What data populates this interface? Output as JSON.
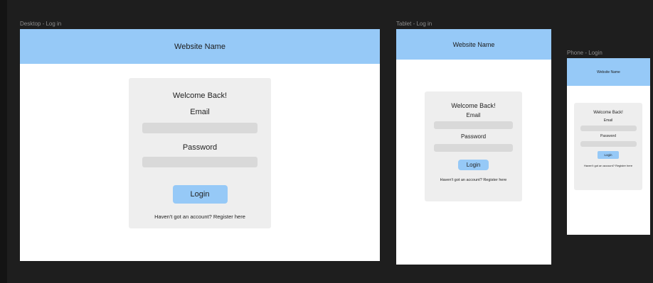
{
  "frames": {
    "desktop": {
      "label": "Desktop - Log in",
      "header": "Website Name",
      "welcome": "Welcome Back!",
      "email_label": "Email",
      "password_label": "Password",
      "login_button": "Login",
      "register_text": "Haven't got an account? Register here"
    },
    "tablet": {
      "label": "Tablet - Log in",
      "header": "Website Name",
      "welcome": "Welcome Back!",
      "email_label": "Email",
      "password_label": "Password",
      "login_button": "Login",
      "register_text": "Haven't got an account? Register here"
    },
    "phone": {
      "label": "Phone - Login",
      "header": "Website Name",
      "welcome": "Welcome Back!",
      "email_label": "Email",
      "password_label": "Password",
      "login_button": "Login",
      "register_text": "Haven't got an account? Register here"
    }
  },
  "colors": {
    "canvas": "#1e1e1e",
    "header": "#96c9f7",
    "card": "#eeeeee",
    "field": "#d9d9d9",
    "button": "#96c9f7"
  }
}
